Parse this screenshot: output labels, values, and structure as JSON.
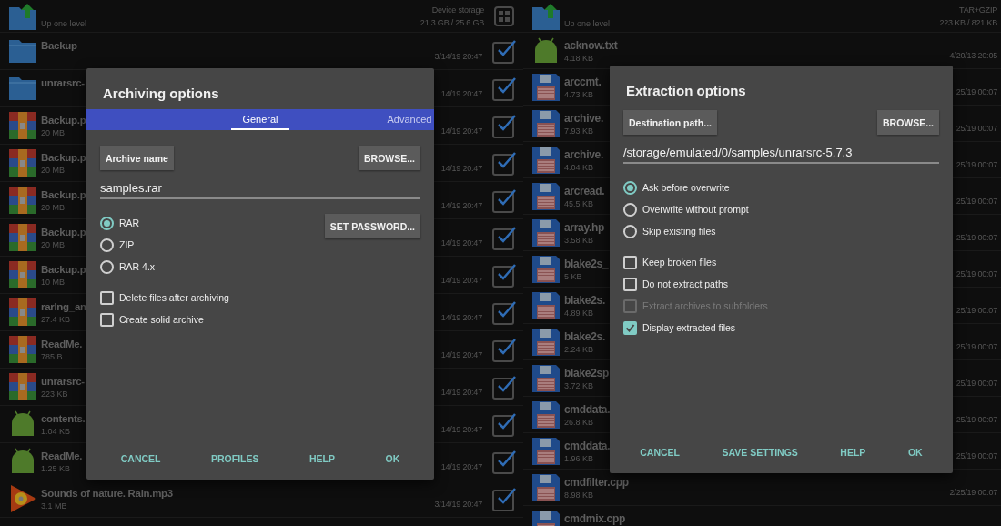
{
  "left_panel": {
    "header": {
      "label": "Up one level",
      "info_title": "Device storage",
      "info_value": "21.3 GB / 25.6 GB"
    },
    "rows": [
      {
        "kind": "folder",
        "name": "Backup",
        "size": "",
        "date": "3/14/19 20:47",
        "checked": true
      },
      {
        "kind": "folder",
        "name": "unrarsrc-",
        "size": "",
        "date": "14/19 20:47",
        "checked": true
      },
      {
        "kind": "archive",
        "name": "Backup.p",
        "size": "20 MB",
        "date": "14/19 20:47",
        "checked": true
      },
      {
        "kind": "archive",
        "name": "Backup.p",
        "size": "20 MB",
        "date": "14/19 20:47",
        "checked": true
      },
      {
        "kind": "archive",
        "name": "Backup.p",
        "size": "20 MB",
        "date": "14/19 20:47",
        "checked": true
      },
      {
        "kind": "archive",
        "name": "Backup.p",
        "size": "20 MB",
        "date": "14/19 20:47",
        "checked": true
      },
      {
        "kind": "archive",
        "name": "Backup.p",
        "size": "10 MB",
        "date": "14/19 20:47",
        "checked": true
      },
      {
        "kind": "archive",
        "name": "rarlng_an",
        "size": "27.4 KB",
        "date": "14/19 20:47",
        "checked": true
      },
      {
        "kind": "archive",
        "name": "ReadMe.",
        "size": "785 B",
        "date": "14/19 20:47",
        "checked": true
      },
      {
        "kind": "archive",
        "name": "unrarsrc-",
        "size": "223 KB",
        "date": "14/19 20:47",
        "checked": true
      },
      {
        "kind": "android",
        "name": "contents.",
        "size": "1.04 KB",
        "date": "14/19 20:47",
        "checked": true
      },
      {
        "kind": "android",
        "name": "ReadMe.",
        "size": "1.25 KB",
        "date": "14/19 20:47",
        "checked": true
      },
      {
        "kind": "audio",
        "name": "Sounds of nature. Rain.mp3",
        "size": "3.1 MB",
        "date": "3/14/19 20:47",
        "checked": true
      }
    ],
    "dialog": {
      "title": "Archiving options",
      "tabs": [
        {
          "label": "General",
          "selected": true
        },
        {
          "label": "Advanced",
          "selected": false
        }
      ],
      "name_button": "Archive name",
      "browse_button": "BROWSE...",
      "field_value": "samples.rar",
      "side_button": "SET PASSWORD...",
      "radios": [
        {
          "label": "RAR",
          "selected": true
        },
        {
          "label": "ZIP",
          "selected": false
        },
        {
          "label": "RAR 4.x",
          "selected": false
        }
      ],
      "checkboxes": [
        {
          "label": "Delete files after archiving",
          "checked": false,
          "disabled": false
        },
        {
          "label": "Create solid archive",
          "checked": false,
          "disabled": false
        }
      ],
      "actions": [
        "CANCEL",
        "PROFILES",
        "HELP",
        "OK"
      ]
    }
  },
  "right_panel": {
    "header": {
      "label": "Up one level",
      "info_title": "TAR+GZIP",
      "info_value": "223 KB / 821 KB"
    },
    "rows": [
      {
        "kind": "android",
        "name": "acknow.txt",
        "size": "4.18 KB",
        "date": "4/20/13 20:05"
      },
      {
        "kind": "source",
        "name": "arccmt.",
        "size": "4.73 KB",
        "date": "25/19 00:07"
      },
      {
        "kind": "source",
        "name": "archive.",
        "size": "7.93 KB",
        "date": "25/19 00:07"
      },
      {
        "kind": "source",
        "name": "archive.",
        "size": "4.04 KB",
        "date": "25/19 00:07"
      },
      {
        "kind": "source",
        "name": "arcread.",
        "size": "45.5 KB",
        "date": "25/19 00:07"
      },
      {
        "kind": "source",
        "name": "array.hp",
        "size": "3.58 KB",
        "date": "25/19 00:07"
      },
      {
        "kind": "source",
        "name": "blake2s_",
        "size": "5 KB",
        "date": "25/19 00:07"
      },
      {
        "kind": "source",
        "name": "blake2s.",
        "size": "4.89 KB",
        "date": "25/19 00:07"
      },
      {
        "kind": "source",
        "name": "blake2s.",
        "size": "2.24 KB",
        "date": "25/19 00:07"
      },
      {
        "kind": "source",
        "name": "blake2sp",
        "size": "3.72 KB",
        "date": "25/19 00:07"
      },
      {
        "kind": "source",
        "name": "cmddata.",
        "size": "26.8 KB",
        "date": "25/19 00:07"
      },
      {
        "kind": "source",
        "name": "cmddata.",
        "size": "1.96 KB",
        "date": "25/19 00:07"
      },
      {
        "kind": "source",
        "name": "cmdfilter.cpp",
        "size": "8.98 KB",
        "date": "2/25/19 00:07"
      },
      {
        "kind": "source",
        "name": "cmdmix.cpp",
        "size": "",
        "date": ""
      }
    ],
    "dialog": {
      "title": "Extraction options",
      "name_button": "Destination path...",
      "browse_button": "BROWSE...",
      "field_value": "/storage/emulated/0/samples/unrarsrc-5.7.3",
      "radios": [
        {
          "label": "Ask before overwrite",
          "selected": true
        },
        {
          "label": "Overwrite without prompt",
          "selected": false
        },
        {
          "label": "Skip existing files",
          "selected": false
        }
      ],
      "checkboxes": [
        {
          "label": "Keep broken files",
          "checked": false,
          "disabled": false
        },
        {
          "label": "Do not extract paths",
          "checked": false,
          "disabled": false
        },
        {
          "label": "Extract archives to subfolders",
          "checked": false,
          "disabled": true
        },
        {
          "label": "Display extracted files",
          "checked": true,
          "disabled": false
        }
      ],
      "actions": [
        "CANCEL",
        "SAVE SETTINGS",
        "HELP",
        "OK"
      ]
    }
  }
}
